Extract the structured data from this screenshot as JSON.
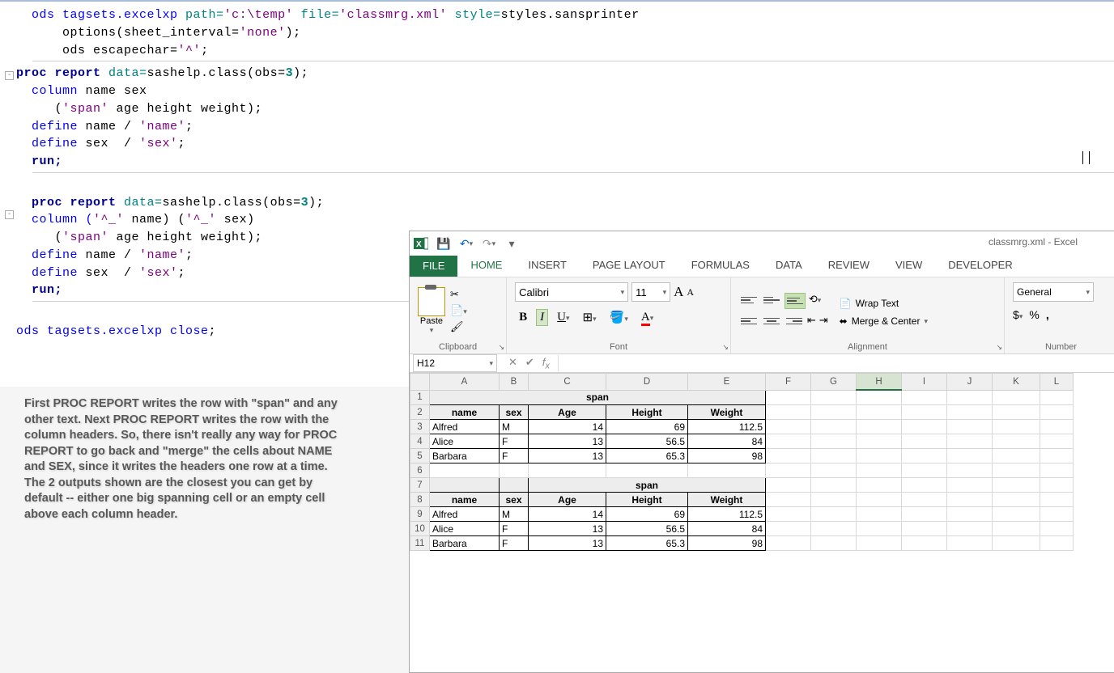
{
  "code": {
    "l1a": "ods tagsets.excelxp ",
    "l1b": "path=",
    "l1c": "'c:\\temp'",
    "l1d": " file=",
    "l1e": "'classmrg.xml'",
    "l1f": " style=",
    "l1g": "styles.sansprinter",
    "l2a": "    options(sheet_interval=",
    "l2b": "'none'",
    "l2c": ");",
    "l3a": "    ods escapechar=",
    "l3b": "'^'",
    "l3c": ";",
    "l4a": "proc",
    "l4b": " report",
    "l4c": " data=",
    "l4d": "sashelp.class(obs=",
    "l4e": "3",
    "l4f": ");",
    "l5a": "  column ",
    "l5b": "name sex",
    "l6a": "     (",
    "l6b": "'span'",
    "l6c": " age height weight);",
    "l7a": "  define ",
    "l7b": "name / ",
    "l7c": "'name'",
    "l7d": ";",
    "l8a": "  define ",
    "l8b": "sex  / ",
    "l8c": "'sex'",
    "l8d": ";",
    "l9a": "  run;",
    "l10a": "  proc",
    "l10b": " report",
    "l10c": " data=",
    "l10d": "sashelp.class(obs=",
    "l10e": "3",
    "l10f": ");",
    "l11a": "  column (",
    "l11b": "'^_'",
    "l11c": " name) (",
    "l11d": "'^_'",
    "l11e": " sex)",
    "l12a": "     (",
    "l12b": "'span'",
    "l12c": " age height weight);",
    "l13a": "  define ",
    "l13b": "name / ",
    "l13c": "'name'",
    "l13d": ";",
    "l14a": "  define ",
    "l14b": "sex  / ",
    "l14c": "'sex'",
    "l14d": ";",
    "l15a": "  run;",
    "l16a": "ods tagsets.excelxp ",
    "l16b": "close",
    "l16c": ";"
  },
  "commentary": "First PROC REPORT writes the row with \"span\" and any other text. Next PROC REPORT writes the row with the column headers. So, there isn't really any way for PROC REPORT to go back and \"merge\" the cells about NAME and SEX, since it writes the headers one row at a time. The 2 outputs shown are the closest you can get by default -- either one big spanning cell or an empty cell above each column header.",
  "excel": {
    "title": "classmrg.xml - Excel",
    "tabs": {
      "file": "FILE",
      "home": "HOME",
      "insert": "INSERT",
      "pagelayout": "PAGE LAYOUT",
      "formulas": "FORMULAS",
      "data": "DATA",
      "review": "REVIEW",
      "view": "VIEW",
      "developer": "DEVELOPER"
    },
    "ribbon": {
      "paste": "Paste",
      "clipboard": "Clipboard",
      "font_name": "Calibri",
      "font_size": "11",
      "font_group": "Font",
      "wrap": "Wrap Text",
      "merge": "Merge & Center",
      "alignment": "Alignment",
      "number_format": "General",
      "number_group": "Number"
    },
    "namebox": "H12",
    "columns": [
      "A",
      "B",
      "C",
      "D",
      "E",
      "F",
      "G",
      "H",
      "I",
      "J",
      "K",
      "L"
    ],
    "rows": [
      "1",
      "2",
      "3",
      "4",
      "5",
      "6",
      "7",
      "8",
      "9",
      "10",
      "11"
    ],
    "selected_column": "H",
    "table1": {
      "span_row": 1,
      "header_row": 2,
      "span_label": "span",
      "headers": [
        "name",
        "sex",
        "Age",
        "Height",
        "Weight"
      ],
      "data": [
        {
          "r": 3,
          "name": "Alfred",
          "sex": "M",
          "age": 14,
          "height": 69,
          "weight": 112.5
        },
        {
          "r": 4,
          "name": "Alice",
          "sex": "F",
          "age": 13,
          "height": 56.5,
          "weight": 84
        },
        {
          "r": 5,
          "name": "Barbara",
          "sex": "F",
          "age": 13,
          "height": 65.3,
          "weight": 98
        }
      ]
    },
    "table2": {
      "span_row": 7,
      "header_row": 8,
      "span_label": "span",
      "headers": [
        "name",
        "sex",
        "Age",
        "Height",
        "Weight"
      ],
      "data": [
        {
          "r": 9,
          "name": "Alfred",
          "sex": "M",
          "age": 14,
          "height": 69,
          "weight": 112.5
        },
        {
          "r": 10,
          "name": "Alice",
          "sex": "F",
          "age": 13,
          "height": 56.5,
          "weight": 84
        },
        {
          "r": 11,
          "name": "Barbara",
          "sex": "F",
          "age": 13,
          "height": 65.3,
          "weight": 98
        }
      ]
    }
  },
  "chart_data": {
    "type": "table",
    "title": "span",
    "columns": [
      "name",
      "sex",
      "Age",
      "Height",
      "Weight"
    ],
    "rows": [
      [
        "Alfred",
        "M",
        14,
        69,
        112.5
      ],
      [
        "Alice",
        "F",
        13,
        56.5,
        84
      ],
      [
        "Barbara",
        "F",
        13,
        65.3,
        98
      ]
    ]
  }
}
